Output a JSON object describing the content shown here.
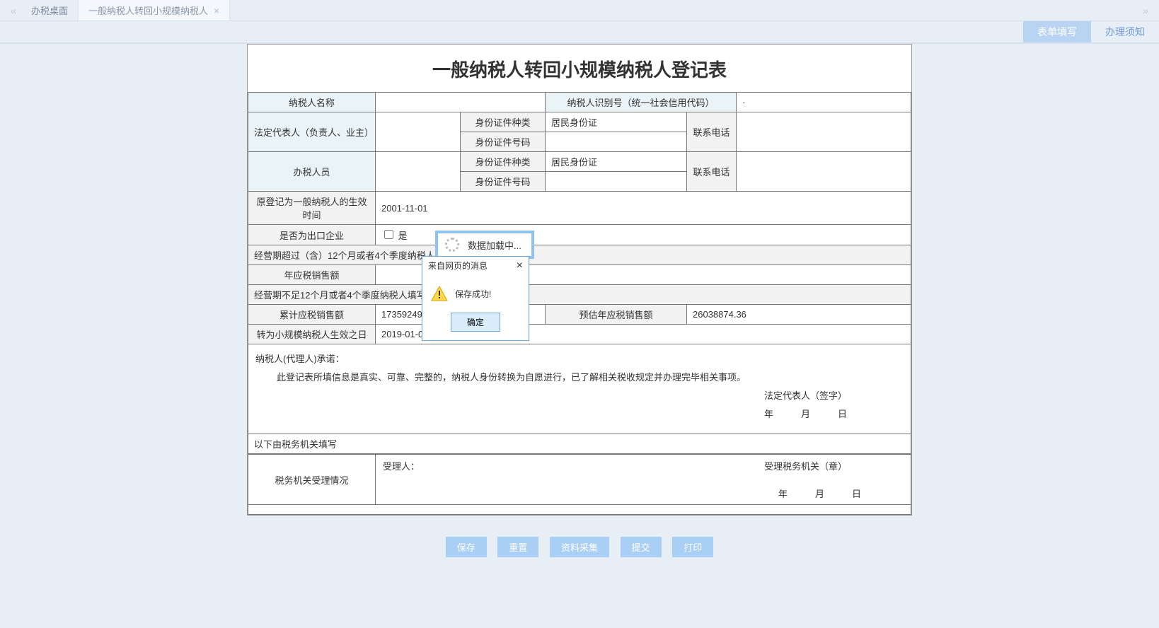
{
  "tabs": {
    "home": "办税桌面",
    "current": "一般纳税人转回小规模纳税人"
  },
  "actions": {
    "form_fill": "表单填写",
    "instructions": "办理须知"
  },
  "title": "一般纳税人转回小规模纳税人登记表",
  "labels": {
    "taxpayer_name": "纳税人名称",
    "taxpayer_id": "纳税人识别号（统一社会信用代码）",
    "legal_rep": "法定代表人（负责人、业主）",
    "id_type": "身份证件种类",
    "id_num": "身份证件号码",
    "contact_phone": "联系电话",
    "tax_agent": "办税人员",
    "orig_general_date": "原登记为一般纳税人的生效时间",
    "is_export": "是否为出口企业",
    "export_checkbox": "是",
    "section_over12": "经营期超过（含）12个月或者4个季度纳税人填写",
    "annual_sales": "年应税销售额",
    "section_under12": "经营期不足12个月或者4个季度纳税人填写",
    "cum_sales": "累计应税销售额",
    "est_annual_sales": "预估年应税销售额",
    "convert_date": "转为小规模纳税人生效之日",
    "promise_title": "纳税人(代理人)承诺：",
    "promise_body": "此登记表所填信息是真实、可靠、完整的，纳税人身份转换为自愿进行，已了解相关税收规定并办理完毕相关事项。",
    "legal_sign": "法定代表人（签字）",
    "date_ymd": "年　　　月　　　日",
    "authority_section": "以下由税务机关填写",
    "authority_status": "税务机关受理情况",
    "acceptor": "受理人：",
    "authority_stamp": "受理税务机关（章）"
  },
  "values": {
    "taxpayer_name": "",
    "taxpayer_id": "·",
    "legal_rep_name": "",
    "legal_rep_id_type": "居民身份证",
    "legal_rep_id_num": "",
    "legal_rep_phone": "",
    "agent_name": "",
    "agent_id_type": "居民身份证",
    "agent_id_num": "",
    "agent_phone": "",
    "orig_general_date": "2001-11-01",
    "annual_sales": "",
    "cum_sales": "17359249.57",
    "est_annual_sales": "26038874.36",
    "convert_date": "2019-01-01"
  },
  "loading_text": "数据加载中...",
  "dialog": {
    "title": "来自网页的消息",
    "message": "保存成功!",
    "ok": "确定"
  },
  "buttons": {
    "save": "保存",
    "reset": "重置",
    "collect": "资料采集",
    "submit": "提交",
    "print": "打印"
  }
}
